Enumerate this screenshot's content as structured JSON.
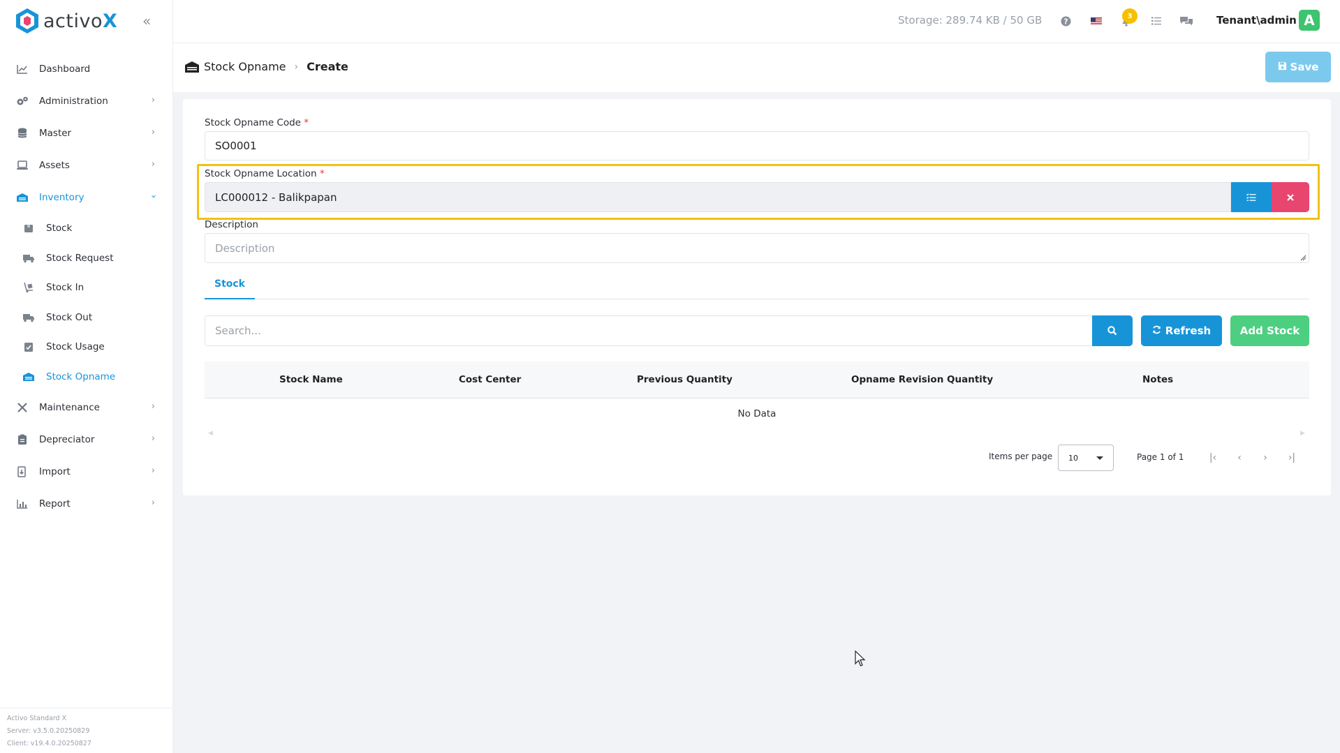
{
  "app": {
    "logo_text": "activo",
    "logo_x": "X"
  },
  "sidebar": {
    "items": [
      {
        "label": "Dashboard",
        "icon": "chart-line-icon"
      },
      {
        "label": "Administration",
        "icon": "cogs-icon"
      },
      {
        "label": "Master",
        "icon": "database-icon"
      },
      {
        "label": "Assets",
        "icon": "laptop-icon"
      },
      {
        "label": "Inventory",
        "icon": "warehouse-icon"
      },
      {
        "label": "Maintenance",
        "icon": "tools-icon"
      },
      {
        "label": "Depreciator",
        "icon": "clipboard-icon"
      },
      {
        "label": "Import",
        "icon": "import-icon"
      },
      {
        "label": "Report",
        "icon": "bar-chart-icon"
      }
    ],
    "inventory_sub": [
      {
        "label": "Stock"
      },
      {
        "label": "Stock Request"
      },
      {
        "label": "Stock In"
      },
      {
        "label": "Stock Out"
      },
      {
        "label": "Stock Usage"
      },
      {
        "label": "Stock Opname"
      }
    ],
    "version": {
      "product": "Activo Standard X",
      "server": "Server: v3.5.0.20250829",
      "client": "Client: v19.4.0.20250827"
    }
  },
  "topbar": {
    "storage": "Storage: 289.74 KB / 50 GB",
    "notification_count": "3",
    "user": "Tenant\\admin",
    "avatar_letter": "A"
  },
  "header": {
    "breadcrumb_parent": "Stock Opname",
    "breadcrumb_current": "Create",
    "save_label": "Save"
  },
  "form": {
    "code_label": "Stock Opname Code",
    "code_value": "SO0001",
    "location_label": "Stock Opname Location",
    "location_value": "LC000012 - Balikpapan",
    "description_label": "Description",
    "description_placeholder": "Description",
    "required_mark": "*"
  },
  "tabs": [
    {
      "label": "Stock"
    }
  ],
  "toolbar": {
    "search_placeholder": "Search...",
    "refresh_label": "Refresh",
    "add_label": "Add Stock"
  },
  "table": {
    "columns": [
      "Stock Name",
      "Cost Center",
      "Previous Quantity",
      "Opname Revision Quantity",
      "Notes"
    ],
    "empty_text": "No Data"
  },
  "paginator": {
    "items_per_page_label": "Items per page",
    "items_per_page_value": "10",
    "page_label": "Page 1 of 1"
  },
  "colors": {
    "accent": "#1794d8",
    "danger": "#e8456f",
    "success": "#4ccf80",
    "highlight": "#f3c10d",
    "badge": "#f6c000"
  }
}
